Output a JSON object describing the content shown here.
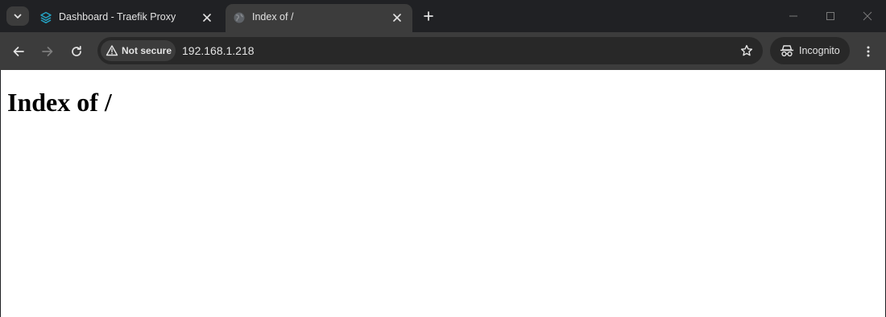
{
  "tabs": [
    {
      "title": "Dashboard - Traefik Proxy",
      "active": false,
      "favicon": "traefik-logo-icon"
    },
    {
      "title": "Index of /",
      "active": true,
      "favicon": "globe-icon"
    }
  ],
  "toolbar": {
    "security_label": "Not secure",
    "url": "192.168.1.218",
    "incognito_label": "Incognito"
  },
  "page": {
    "heading": "Index of /"
  },
  "colors": {
    "frame": "#202124",
    "toolbar": "#3c3c3c",
    "omnibox": "#282828",
    "text_light": "#e3e3e3",
    "traefik_accent": "#24a1c1",
    "page_background": "#ffffff"
  }
}
